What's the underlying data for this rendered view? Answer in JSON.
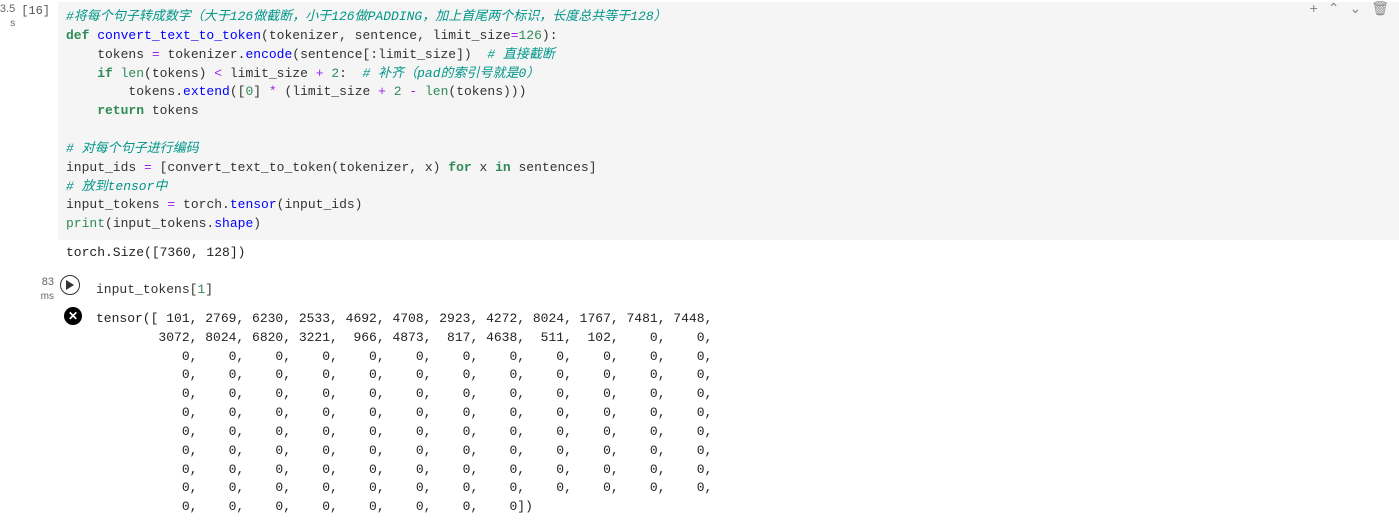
{
  "toolbar": {
    "add": "+",
    "up": "⌃",
    "down": "⌄",
    "delete": "🗑"
  },
  "cell1": {
    "exec_time": "3.5",
    "exec_unit": "s",
    "exec_count": "[16]",
    "code": {
      "line1_comment": "#将每个句子转成数字（大于126做截断，小于126做PADDING，加上首尾两个标识，长度总共等于128）",
      "line2_def": "def",
      "line2_name": "convert_text_to_token",
      "line2_params_open": "(tokenizer, sentence, limit_size",
      "line2_eq": "=",
      "line2_num": "126",
      "line2_close": "):",
      "line3_a": "    tokens ",
      "line3_eq": "=",
      "line3_b": " tokenizer.",
      "line3_encode": "encode",
      "line3_c": "(sentence[:limit_size])  ",
      "line3_comment": "# 直接截断",
      "line4_if": "    if",
      "line4_a": " ",
      "line4_len": "len",
      "line4_b": "(tokens) ",
      "line4_lt": "<",
      "line4_c": " limit_size ",
      "line4_plus": "+",
      "line4_d": " ",
      "line4_num": "2",
      "line4_e": ":  ",
      "line4_comment": "# 补齐（pad的索引号就是0）",
      "line5_a": "        tokens.",
      "line5_extend": "extend",
      "line5_b": "([",
      "line5_zero": "0",
      "line5_c": "] ",
      "line5_mul": "*",
      "line5_d": " (limit_size ",
      "line5_plus": "+",
      "line5_e": " ",
      "line5_two": "2",
      "line5_f": " ",
      "line5_minus": "-",
      "line5_g": " ",
      "line5_len": "len",
      "line5_h": "(tokens)))",
      "line6_return": "    return",
      "line6_b": " tokens",
      "line8_comment": "# 对每个句子进行编码",
      "line9_a": "input_ids ",
      "line9_eq": "=",
      "line9_b": " [convert_text_to_token(tokenizer, x) ",
      "line9_for": "for",
      "line9_c": " x ",
      "line9_in": "in",
      "line9_d": " sentences]",
      "line10_comment": "# 放到tensor中",
      "line11_a": "input_tokens ",
      "line11_eq": "=",
      "line11_b": " torch.",
      "line11_tensor": "tensor",
      "line11_c": "(input_ids)",
      "line12_print": "print",
      "line12_a": "(input_tokens.",
      "line12_shape": "shape",
      "line12_b": ")"
    },
    "output": "torch.Size([7360, 128])"
  },
  "cell2": {
    "exec_time": "83",
    "exec_unit": "ms",
    "code": {
      "line1_a": "input_tokens[",
      "line1_num": "1",
      "line1_b": "]"
    },
    "output": "tensor([ 101, 2769, 6230, 2533, 4692, 4708, 2923, 4272, 8024, 1767, 7481, 7448,\n        3072, 8024, 6820, 3221,  966, 4873,  817, 4638,  511,  102,    0,    0,\n           0,    0,    0,    0,    0,    0,    0,    0,    0,    0,    0,    0,\n           0,    0,    0,    0,    0,    0,    0,    0,    0,    0,    0,    0,\n           0,    0,    0,    0,    0,    0,    0,    0,    0,    0,    0,    0,\n           0,    0,    0,    0,    0,    0,    0,    0,    0,    0,    0,    0,\n           0,    0,    0,    0,    0,    0,    0,    0,    0,    0,    0,    0,\n           0,    0,    0,    0,    0,    0,    0,    0,    0,    0,    0,    0,\n           0,    0,    0,    0,    0,    0,    0,    0,    0,    0,    0,    0,\n           0,    0,    0,    0,    0,    0,    0,    0,    0,    0,    0,    0,\n           0,    0,    0,    0,    0,    0,    0,    0])"
  }
}
